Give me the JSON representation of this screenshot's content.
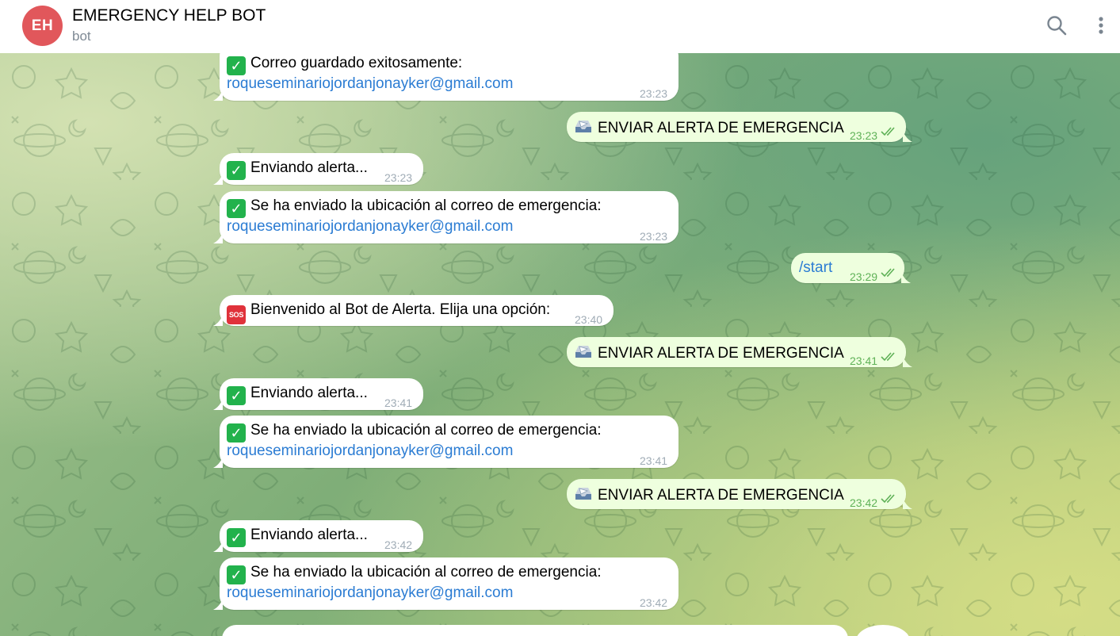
{
  "header": {
    "avatar_initials": "EH",
    "title": "EMERGENCY HELP BOT",
    "subtitle": "bot",
    "avatar_color": "#e1575b"
  },
  "messages": [
    {
      "dir": "in",
      "icon": "check-icon",
      "text": "Correo guardado exitosamente:",
      "link": "roqueseminariojordanjonayker@gmail.com",
      "time": "23:23"
    },
    {
      "dir": "out",
      "icon": "inbox-tray-icon",
      "text": "ENVIAR ALERTA DE EMERGENCIA",
      "time": "23:23"
    },
    {
      "dir": "in",
      "icon": "check-icon",
      "text": "Enviando alerta...",
      "time": "23:23"
    },
    {
      "dir": "in",
      "icon": "check-icon",
      "text": "Se ha enviado la ubicación al correo de emergencia:",
      "link": "roqueseminariojordanjonayker@gmail.com",
      "time": "23:23"
    },
    {
      "dir": "out",
      "text": "/start",
      "time": "23:29"
    },
    {
      "dir": "in",
      "icon": "sos-icon",
      "text": "Bienvenido al Bot de Alerta. Elija una opción:",
      "time": "23:40"
    },
    {
      "dir": "out",
      "icon": "inbox-tray-icon",
      "text": "ENVIAR ALERTA DE EMERGENCIA",
      "time": "23:41"
    },
    {
      "dir": "in",
      "icon": "check-icon",
      "text": "Enviando alerta...",
      "time": "23:41"
    },
    {
      "dir": "in",
      "icon": "check-icon",
      "text": "Se ha enviado la ubicación al correo de emergencia:",
      "link": "roqueseminariojordanjonayker@gmail.com",
      "time": "23:41"
    },
    {
      "dir": "out",
      "icon": "inbox-tray-icon",
      "text": "ENVIAR ALERTA DE EMERGENCIA",
      "time": "23:42"
    },
    {
      "dir": "in",
      "icon": "check-icon",
      "text": "Enviando alerta...",
      "time": "23:42"
    },
    {
      "dir": "in",
      "icon": "check-icon",
      "text": "Se ha enviado la ubicación al correo de emergencia:",
      "link": "roqueseminariojordanjonayker@gmail.com",
      "time": "23:42"
    }
  ],
  "emoji_glyphs": {
    "check": "✓",
    "sos": "SOS"
  },
  "colors": {
    "outgoing_bubble": "#eeffde",
    "incoming_bubble": "#ffffff",
    "link": "#2b7cd3",
    "read_ticks": "#5fb157"
  }
}
